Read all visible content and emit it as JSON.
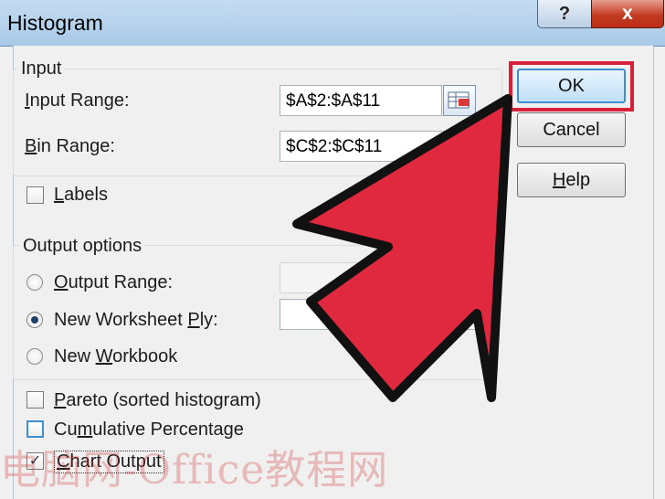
{
  "window": {
    "title": "Histogram",
    "help_glyph": "?",
    "close_glyph": "x"
  },
  "input_group": {
    "legend": "Input",
    "input_range_label": "Input Range:",
    "input_range_value": "$A$2:$A$11",
    "bin_range_label": "Bin Range:",
    "bin_range_value": "$C$2:$C$11"
  },
  "labels_checkbox": {
    "label": "Labels",
    "checked": false
  },
  "output_group": {
    "legend": "Output options",
    "output_range_label": "Output Range:",
    "new_worksheet_label": "New Worksheet Ply:",
    "new_workbook_label": "New Workbook",
    "selected": "New Worksheet Ply"
  },
  "options": {
    "pareto_label": "Pareto (sorted histogram)",
    "cumulative_label": "Cumulative Percentage",
    "chart_output_label": "Chart Output",
    "chart_output_checked": true,
    "check_glyph": "✓"
  },
  "buttons": {
    "ok": "OK",
    "cancel": "Cancel",
    "help": "Help"
  },
  "annotation": {
    "arrow_color": "#e0283e",
    "outline_color": "#111111"
  },
  "watermark": "电脑网-Office教程网"
}
